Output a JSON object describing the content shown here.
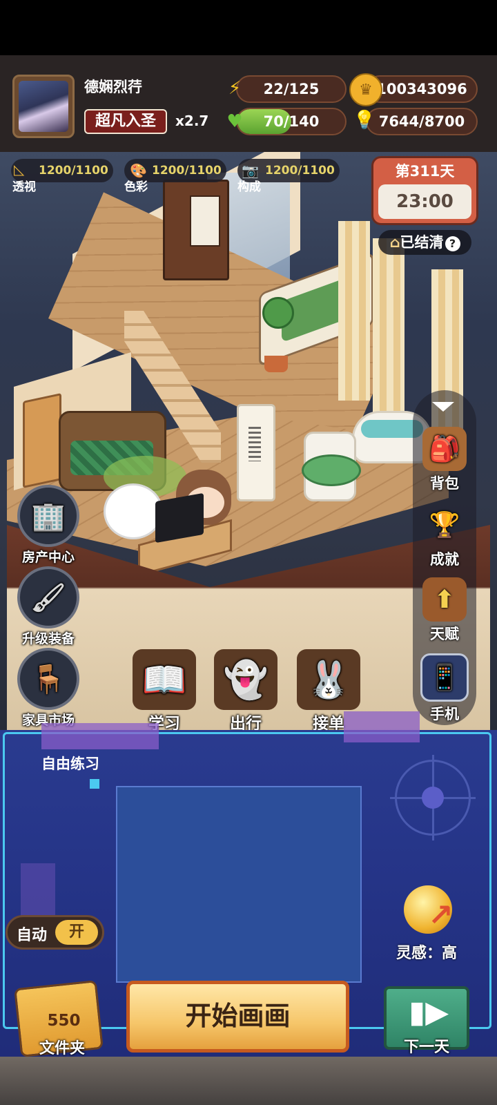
{
  "player": {
    "name": "德娴烈荇",
    "rank": "超凡入圣",
    "multiplier": "x2.7"
  },
  "resources": {
    "energy": {
      "text": "22/125",
      "icon": "lightning-icon",
      "level": 0.176
    },
    "coins": {
      "text": "100343096",
      "icon": "coin-icon"
    },
    "health": {
      "text": "70/140",
      "icon": "heart-icon",
      "level": 0.5
    },
    "ideas": {
      "text": "7644/8700",
      "icon": "lightbulb-icon"
    }
  },
  "stats": [
    {
      "value": "1200/1100",
      "label": "透视",
      "icon": "ruler-icon"
    },
    {
      "value": "1200/1100",
      "label": "色彩",
      "icon": "palette-icon"
    },
    {
      "value": "1200/1100",
      "label": "构成",
      "icon": "camera-icon"
    }
  ],
  "calendar": {
    "day": "第311天",
    "time": "23:00",
    "settled": "已结清"
  },
  "side_menu": [
    {
      "label": "背包",
      "icon": "backpack-icon"
    },
    {
      "label": "成就",
      "icon": "trophy-icon"
    },
    {
      "label": "天赋",
      "icon": "talent-book-icon"
    },
    {
      "label": "手机",
      "icon": "phone-icon"
    }
  ],
  "left_menu": [
    {
      "label": "房产中心",
      "icon": "building-icon"
    },
    {
      "label": "升级装备",
      "icon": "brush-pen-icon"
    },
    {
      "label": "家具市场",
      "icon": "furniture-icon"
    }
  ],
  "actions": [
    {
      "label": "学习",
      "icon": "book-icon"
    },
    {
      "label": "出行",
      "icon": "ghost-travel-icon"
    },
    {
      "label": "接单",
      "icon": "rabbit-order-icon"
    }
  ],
  "panel": {
    "title": "自由练习",
    "auto_label": "自动",
    "auto_state": "开",
    "inspiration": "灵感：高",
    "folder_count": "550",
    "folder_label": "文件夹",
    "start_button": "开始画画",
    "next_day": "下一天"
  },
  "colors": {
    "header_bg": "#2a2424",
    "panel_bg": "#253487",
    "panel_border": "#4bc9f0",
    "start_button": "#f6c66a",
    "rank_badge": "#7a1f1c"
  }
}
